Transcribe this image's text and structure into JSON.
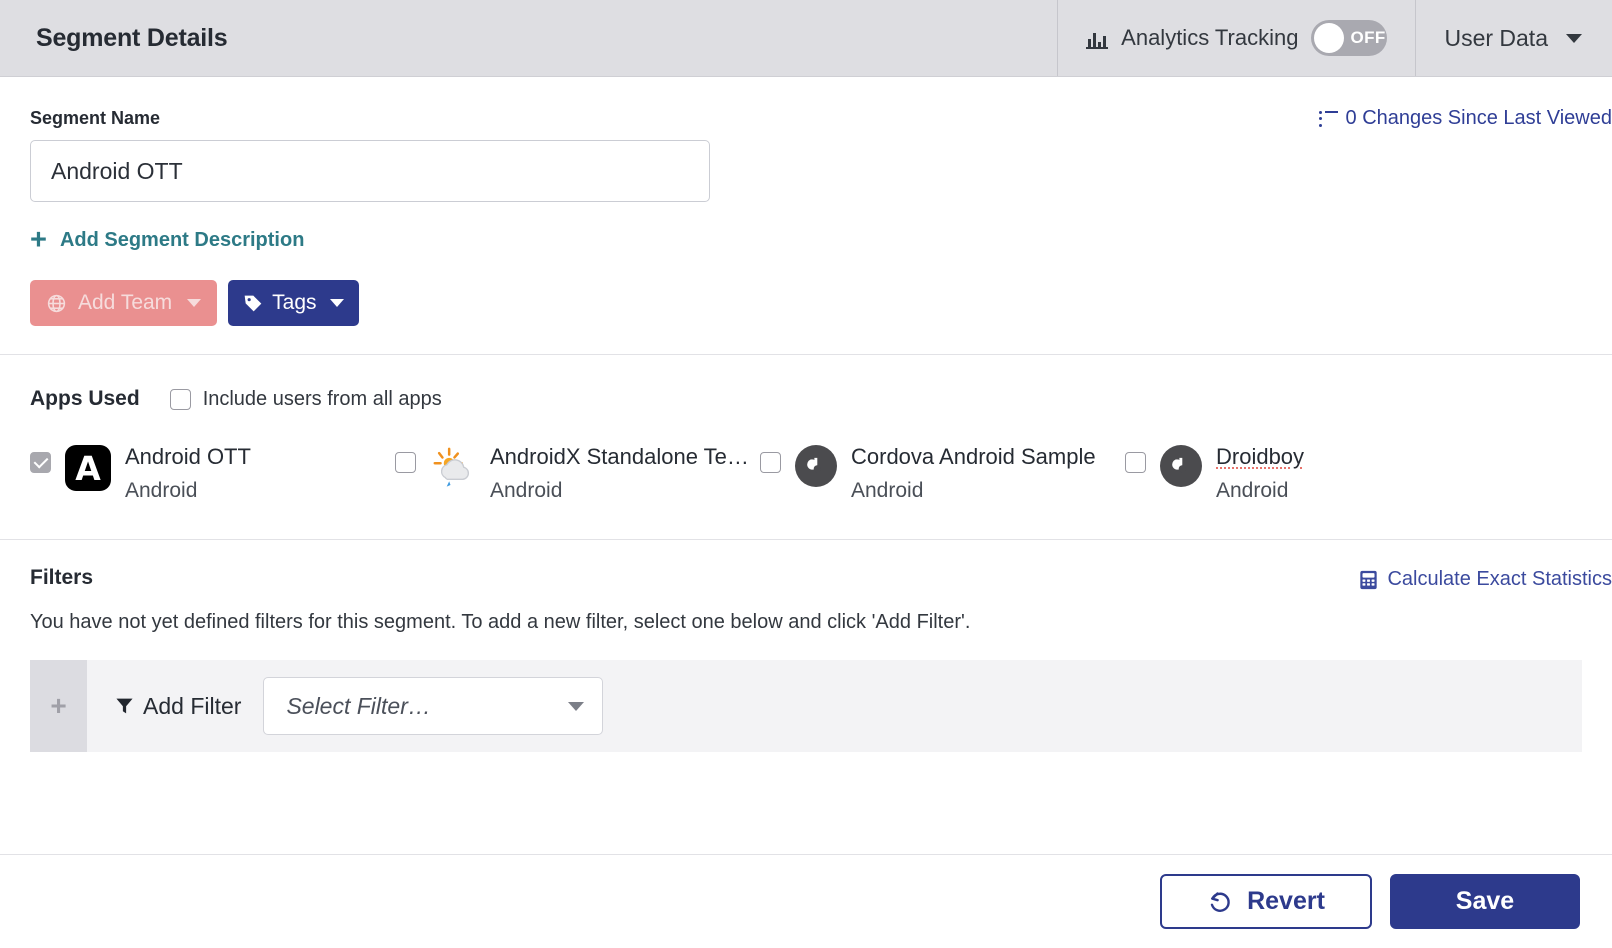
{
  "header": {
    "title": "Segment Details",
    "analytics": {
      "label": "Analytics Tracking",
      "toggle_state": "OFF",
      "icon": "bar-chart-icon"
    },
    "user_data": {
      "label": "User Data",
      "icon": "chevron-down-icon"
    }
  },
  "segment": {
    "name_label": "Segment Name",
    "name_value": "Android OTT",
    "name_placeholder": "Segment Name",
    "changes_link": "0 Changes Since Last Viewed",
    "changes_icon": "list-icon",
    "add_description": "Add Segment Description",
    "add_description_icon": "plus-icon",
    "add_team": "Add Team",
    "add_team_icon": "globe-icon",
    "tags": "Tags",
    "tags_icon": "tag-icon"
  },
  "apps": {
    "title": "Apps Used",
    "include_all_label": "Include users from all apps",
    "include_all_checked": false,
    "items": [
      {
        "name": "Android OTT",
        "platform": "Android",
        "checked": true,
        "icon": "app-icon-android-ott",
        "glyph": "A",
        "spellcheck_underline": false
      },
      {
        "name": "AndroidX Standalone Te…",
        "platform": "Android",
        "checked": false,
        "icon": "app-icon-weather",
        "glyph": "",
        "spellcheck_underline": false
      },
      {
        "name": "Cordova Android Sample",
        "platform": "Android",
        "checked": false,
        "icon": "app-icon-braze",
        "glyph": "b",
        "spellcheck_underline": false
      },
      {
        "name": "Droidboy",
        "platform": "Android",
        "checked": false,
        "icon": "app-icon-braze",
        "glyph": "b",
        "spellcheck_underline": true
      }
    ]
  },
  "filters": {
    "title": "Filters",
    "calculate_link": "Calculate Exact Statistics",
    "calculate_icon": "calculator-icon",
    "description": "You have not yet defined filters for this segment. To add a new filter, select one below and click 'Add Filter'.",
    "drag_handle": "+",
    "add_filter_label": "Add Filter",
    "add_filter_icon": "funnel-icon",
    "select_placeholder": "Select Filter…"
  },
  "footer": {
    "revert": "Revert",
    "revert_icon": "undo-icon",
    "save": "Save"
  },
  "colors": {
    "navy": "#2d3a8c",
    "salmon": "#ea9090",
    "teal": "#2d7a86",
    "link_blue": "#2f3e96",
    "header_bg": "#dedee2",
    "spell_red": "#e8736c"
  }
}
